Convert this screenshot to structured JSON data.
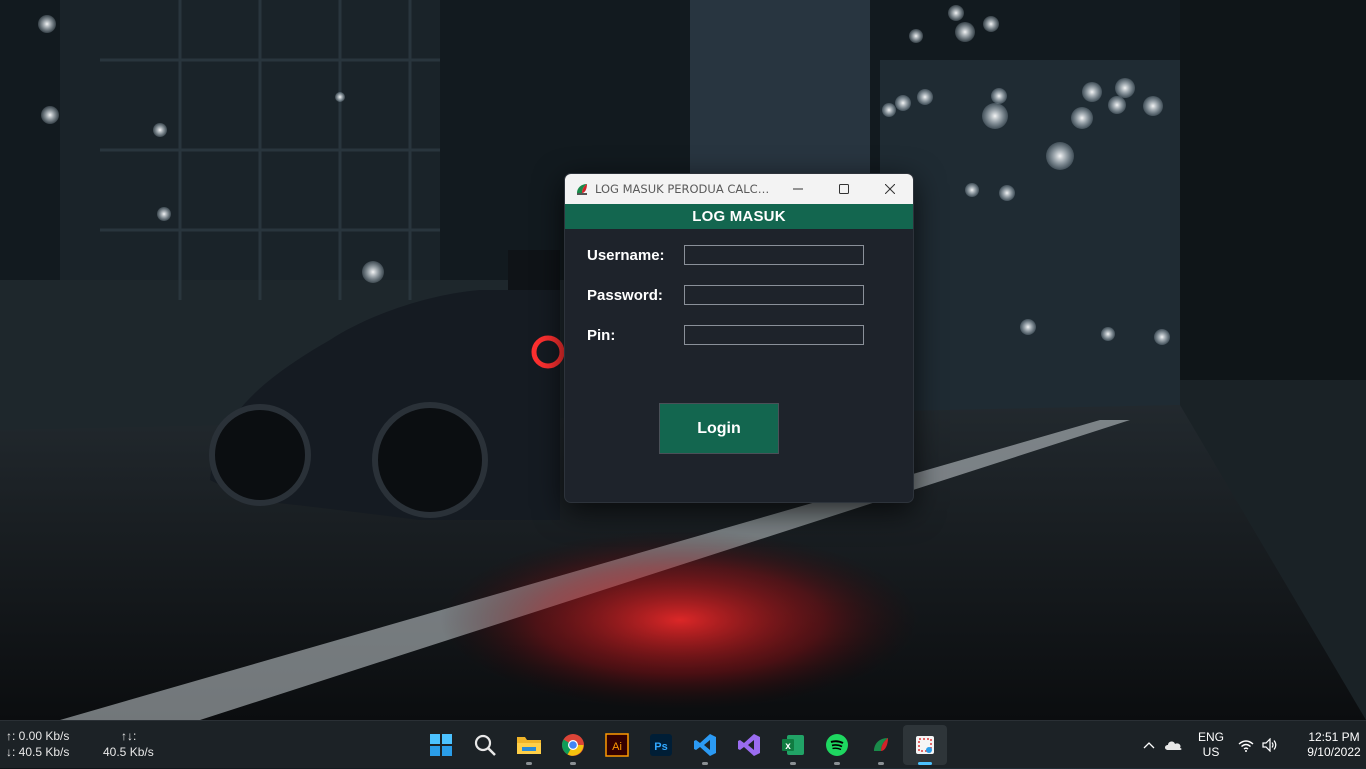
{
  "window": {
    "title": "LOG MASUK PERODUA CALCUL...",
    "header": "LOG MASUK",
    "fields": [
      {
        "label": "Username:",
        "value": ""
      },
      {
        "label": "Password:",
        "value": ""
      },
      {
        "label": "Pin:",
        "value": ""
      }
    ],
    "login_label": "Login"
  },
  "taskbar": {
    "net_up": "↑: 0.00 Kb/s",
    "net_down": "↓: 40.5 Kb/s",
    "net_total_label": "↑↓:",
    "net_total_value": "40.5 Kb/s",
    "apps": [
      "start-icon",
      "search-icon",
      "file-explorer-icon",
      "chrome-icon",
      "illustrator-icon",
      "photoshop-icon",
      "vscode-icon",
      "visual-studio-icon",
      "excel-icon",
      "spotify-icon",
      "perodua-app-icon",
      "snipping-tool-icon"
    ],
    "tray": {
      "lang": "ENG",
      "region": "US",
      "time": "12:51 PM",
      "date": "9/10/2022"
    }
  },
  "colors": {
    "accent": "#13664f",
    "window_bg": "#1e232b",
    "titlebar_bg": "#f3f3f3"
  }
}
